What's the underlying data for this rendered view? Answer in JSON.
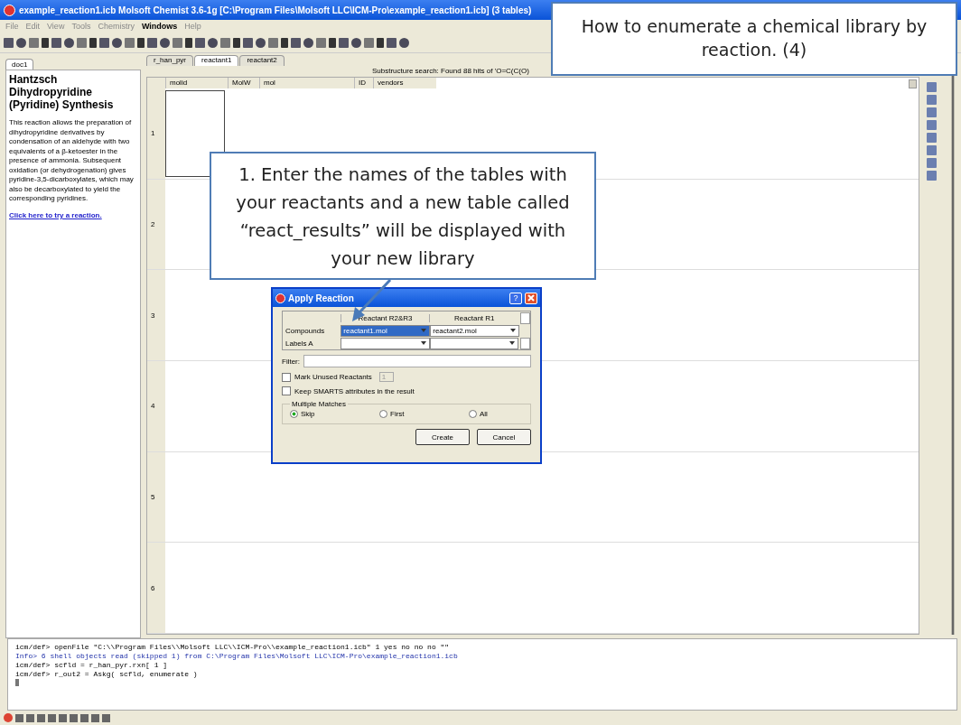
{
  "window": {
    "title": "example_reaction1.icb Molsoft Chemist 3.6-1g  [C:\\Program Files\\Molsoft LLC\\ICM-Pro\\example_reaction1.icb] (3 tables)"
  },
  "menu": [
    {
      "label": "File",
      "selected": false
    },
    {
      "label": "Edit",
      "selected": false
    },
    {
      "label": "View",
      "selected": false
    },
    {
      "label": "Tools",
      "selected": false
    },
    {
      "label": "Chemistry",
      "selected": false
    },
    {
      "label": "Windows",
      "selected": true
    },
    {
      "label": "Help",
      "selected": false
    }
  ],
  "left_panel": {
    "tab": "doc1",
    "heading": "Hantzsch Dihydropyridine (Pyridine) Synthesis",
    "body": "This reaction allows the preparation of dihydropyridine derivatives by condensation of an aldehyde with two equivalents of a β-ketoester in the presence of ammonia. Subsequent oxidation (or dehydrogenation) gives pyridine-3,5-dicarboxylates, which may also be decarboxylated to yield the corresponding pyridines.",
    "link": "Click here to try a reaction."
  },
  "tabs": [
    {
      "label": "r_han_pyr",
      "selected": false
    },
    {
      "label": "reactant1",
      "selected": true
    },
    {
      "label": "reactant2",
      "selected": false
    }
  ],
  "search_status": "Substructure search: Found 88 hits of 'O=C(C(O)",
  "table": {
    "columns": [
      "molid",
      "MolW",
      "mol",
      "ID",
      "vendors"
    ],
    "rows": [
      {
        "index": "1"
      },
      {
        "index": "2"
      },
      {
        "index": "3"
      },
      {
        "index": "4"
      },
      {
        "index": "5"
      },
      {
        "index": "6"
      }
    ]
  },
  "console": [
    {
      "kind": "command",
      "text": "icm/def> openFile \"C:\\\\Program Files\\\\Molsoft LLC\\\\ICM-Pro\\\\example_reaction1.icb\" 1 yes no no no \"\""
    },
    {
      "kind": "info",
      "text": " Info> 6 shell objects read (skipped 1) from C:\\Program Files\\Molsoft LLC\\ICM-Pro\\example_reaction1.icb"
    },
    {
      "kind": "command",
      "text": "icm/def> scfld = r_han_pyr.rxn[ 1 ]"
    },
    {
      "kind": "command",
      "text": "icm/def> r_out2 = Askg( scfld, enumerate )"
    }
  ],
  "callouts": [
    {
      "kind": "header",
      "text": "How to enumerate a chemical library by reaction. (4)"
    },
    {
      "kind": "step",
      "text": "1. Enter the names of the tables with your reactants and a new table called “react_results” will be displayed with your new library"
    }
  ],
  "dialog": {
    "title": "Apply Reaction",
    "help": "?",
    "columns": [
      "Reactant R2&R3",
      "Reactant R1"
    ],
    "rows": [
      {
        "label": "Compounds",
        "cells": [
          {
            "value": "reactant1.mol",
            "selected": true
          },
          {
            "value": "reactant2.mol",
            "selected": false
          }
        ]
      },
      {
        "label": "Labels A",
        "cells": [
          {
            "selected": false
          },
          {
            "selected": false
          }
        ]
      }
    ],
    "filter_label": "Filter:",
    "checks": [
      {
        "label": "Mark Unused Reactants",
        "checked": false,
        "spin": "1"
      },
      {
        "label": "Keep SMARTS attributes in the result",
        "checked": false
      }
    ],
    "group": "Multiple Matches",
    "radios": [
      {
        "label": "Skip",
        "selected": true
      },
      {
        "label": "First",
        "selected": false
      },
      {
        "label": "All",
        "selected": false
      }
    ],
    "buttons": [
      "Create",
      "Cancel"
    ]
  }
}
